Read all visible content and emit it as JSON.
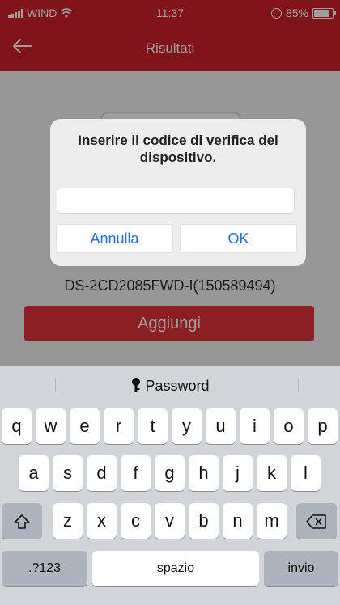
{
  "status_bar": {
    "carrier": "WIND",
    "time": "11:37",
    "battery": "85%",
    "battery_level": 0.85
  },
  "navbar": {
    "back_icon": "arrow-left-icon",
    "title": "Risultati"
  },
  "device": {
    "name": "DS-2CD2085FWD-I(150589494)"
  },
  "add_button": "Aggiungi",
  "alert": {
    "message": "Inserire il codice di verifica del dispositivo.",
    "input_value": "",
    "cancel_label": "Annulla",
    "ok_label": "OK"
  },
  "keyboard": {
    "suggestion": "Password",
    "row1": [
      "q",
      "w",
      "e",
      "r",
      "t",
      "y",
      "u",
      "i",
      "o",
      "p"
    ],
    "row2": [
      "a",
      "s",
      "d",
      "f",
      "g",
      "h",
      "j",
      "k",
      "l"
    ],
    "row3": [
      "z",
      "x",
      "c",
      "v",
      "b",
      "n",
      "m"
    ],
    "numbers_label": ".?123",
    "space_label": "spazio",
    "return_label": "invio",
    "shift_icon": "shift-icon",
    "backspace_icon": "backspace-icon"
  },
  "colors": {
    "brand_red": "#d11f2a",
    "button_red": "#e0333a",
    "ios_blue": "#1f6fe0"
  }
}
